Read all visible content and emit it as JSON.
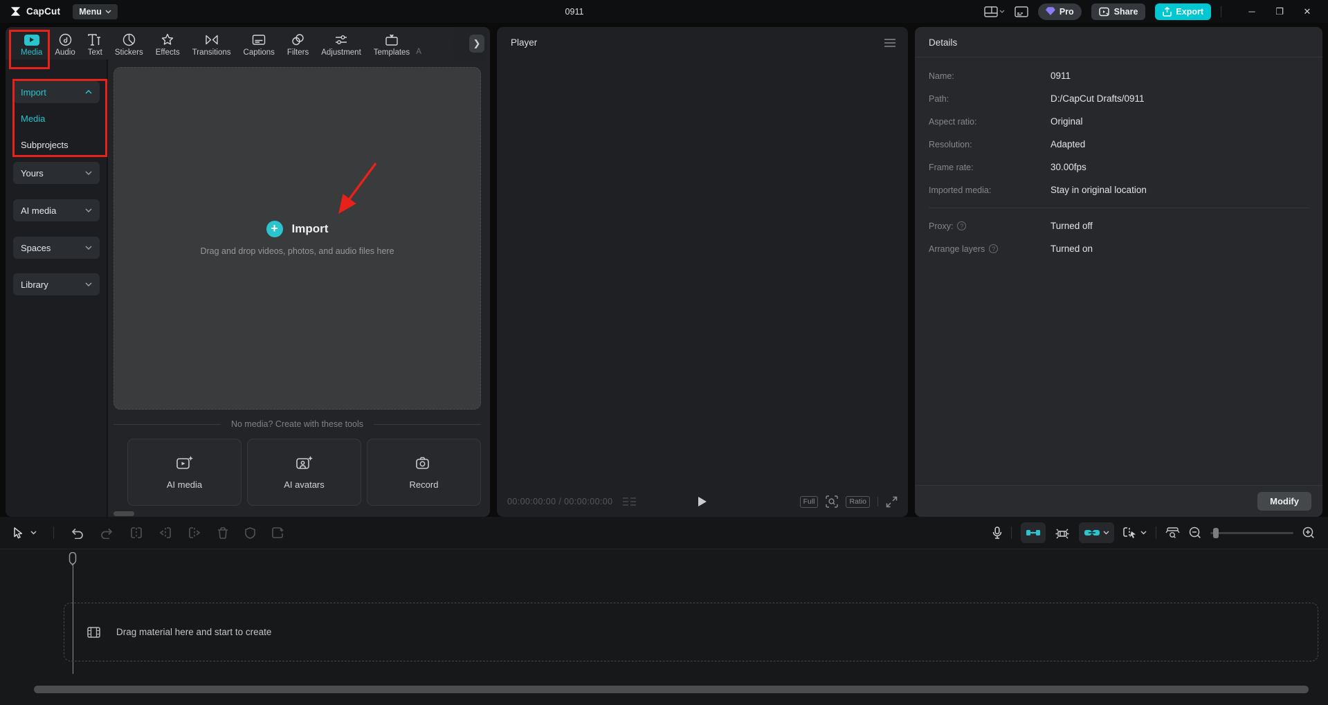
{
  "titlebar": {
    "app_name": "CapCut",
    "menu_label": "Menu",
    "document_title": "0911",
    "pro_label": "Pro",
    "share_label": "Share",
    "export_label": "Export"
  },
  "tabs": [
    {
      "label": "Media",
      "active": true
    },
    {
      "label": "Audio"
    },
    {
      "label": "Text"
    },
    {
      "label": "Stickers"
    },
    {
      "label": "Effects"
    },
    {
      "label": "Transitions"
    },
    {
      "label": "Captions"
    },
    {
      "label": "Filters"
    },
    {
      "label": "Adjustment"
    },
    {
      "label": "Templates"
    }
  ],
  "partial_tab_label": "A",
  "sidebar": {
    "import_label": "Import",
    "items": [
      {
        "label": "Media",
        "selected": true
      },
      {
        "label": "Subprojects"
      }
    ],
    "sections": [
      {
        "label": "Yours"
      },
      {
        "label": "AI media"
      },
      {
        "label": "Spaces"
      },
      {
        "label": "Library"
      }
    ]
  },
  "import_panel": {
    "import_label": "Import",
    "drop_hint": "Drag and drop videos, photos, and audio files here",
    "no_media_text": "No media? Create with these tools",
    "tools": [
      {
        "label": "AI media"
      },
      {
        "label": "AI avatars"
      },
      {
        "label": "Record"
      }
    ]
  },
  "player": {
    "title": "Player",
    "time_current": "00:00:00:00",
    "time_separator": "/",
    "time_total": "00:00:00:00",
    "full_label": "Full",
    "ratio_label": "Ratio"
  },
  "details": {
    "title": "Details",
    "rows": [
      {
        "label": "Name:",
        "value": "0911"
      },
      {
        "label": "Path:",
        "value": "D:/CapCut Drafts/0911"
      },
      {
        "label": "Aspect ratio:",
        "value": "Original"
      },
      {
        "label": "Resolution:",
        "value": "Adapted"
      },
      {
        "label": "Frame rate:",
        "value": "30.00fps"
      },
      {
        "label": "Imported media:",
        "value": "Stay in original location"
      }
    ],
    "proxy": {
      "label": "Proxy:",
      "value": "Turned off"
    },
    "arrange": {
      "label": "Arrange layers",
      "value": "Turned on"
    },
    "modify_label": "Modify"
  },
  "timeline": {
    "drop_text": "Drag material here and start to create"
  },
  "colors": {
    "accent": "#2ac4ce",
    "export_bg": "#00c8d2",
    "annotation_red": "#e8211a",
    "pro_gem": "#8a7bf8",
    "panel_bg": "#222427"
  }
}
